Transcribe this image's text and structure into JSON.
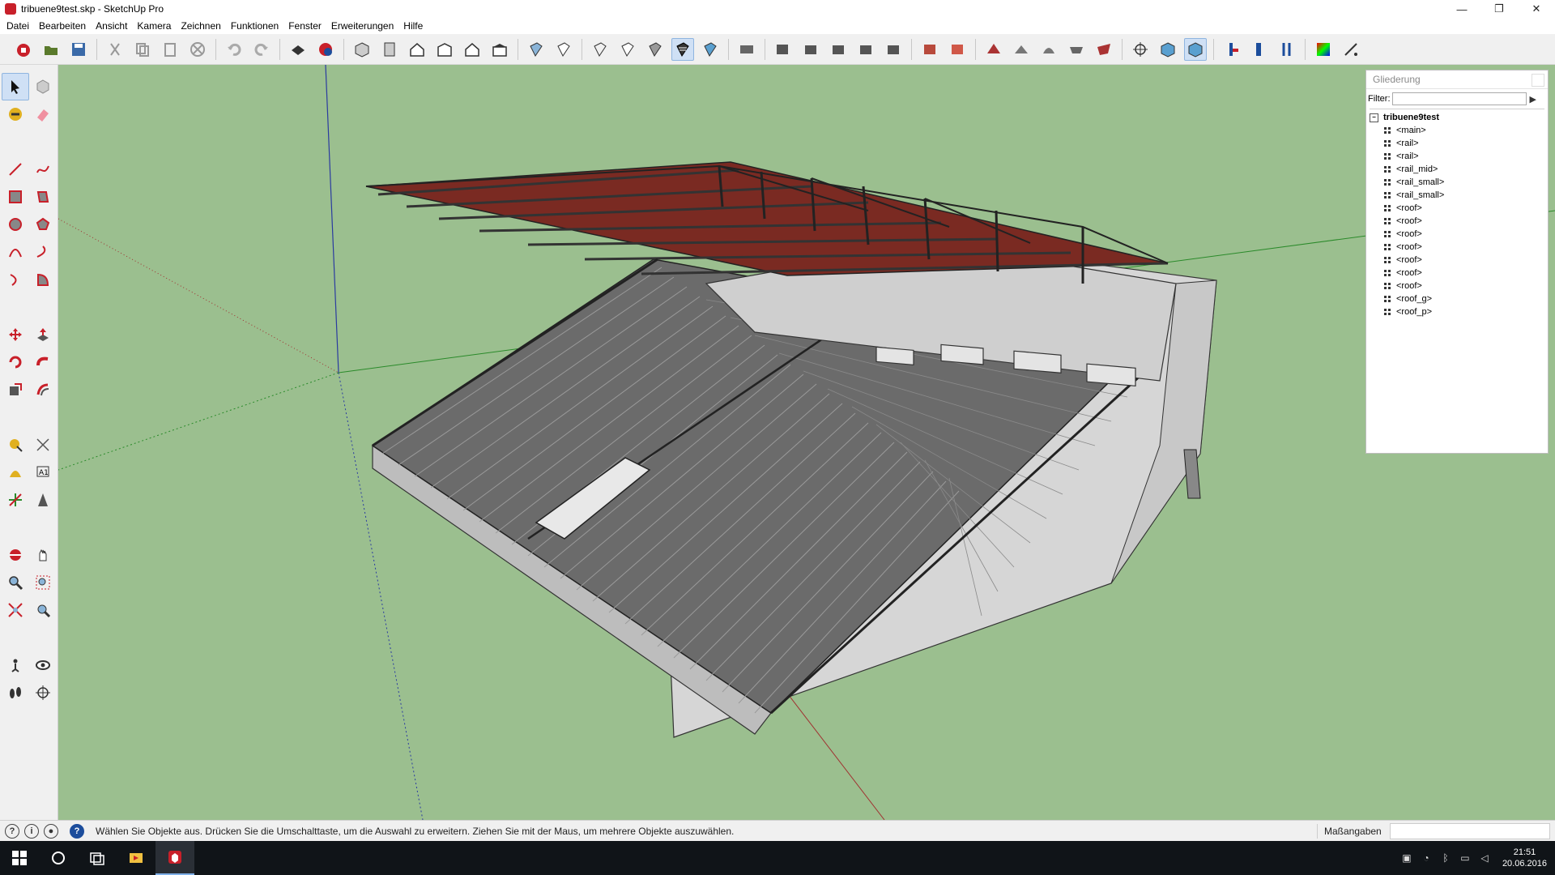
{
  "window": {
    "title": "tribuene9test.skp - SketchUp Pro",
    "controls": [
      "—",
      "❐",
      "✕"
    ]
  },
  "menu": [
    "Datei",
    "Bearbeiten",
    "Ansicht",
    "Kamera",
    "Zeichnen",
    "Funktionen",
    "Fenster",
    "Erweiterungen",
    "Hilfe"
  ],
  "outliner": {
    "title": "Gliederung",
    "filter_label": "Filter:",
    "filter_value": "",
    "root": "tribuene9test",
    "items": [
      "<main>",
      "<rail>",
      "<rail>",
      "<rail_mid>",
      "<rail_small>",
      "<rail_small>",
      "<roof>",
      "<roof>",
      "<roof>",
      "<roof>",
      "<roof>",
      "<roof>",
      "<roof>",
      "<roof_g>",
      "<roof_p>"
    ]
  },
  "status": {
    "message": "Wählen Sie Objekte aus. Drücken Sie die Umschalttaste, um die Auswahl zu erweitern. Ziehen Sie mit der Maus, um mehrere Objekte auszuwählen.",
    "measure_label": "Maßangaben",
    "measure_value": ""
  },
  "taskbar": {
    "time": "21:51",
    "date": "20.06.2016"
  },
  "colors": {
    "sky": "#9bbf8f",
    "roof": "#7a2a22",
    "stand_wall": "#d4d4d4",
    "steps": "#6b6b6b",
    "accent": "#1c4d9c"
  }
}
